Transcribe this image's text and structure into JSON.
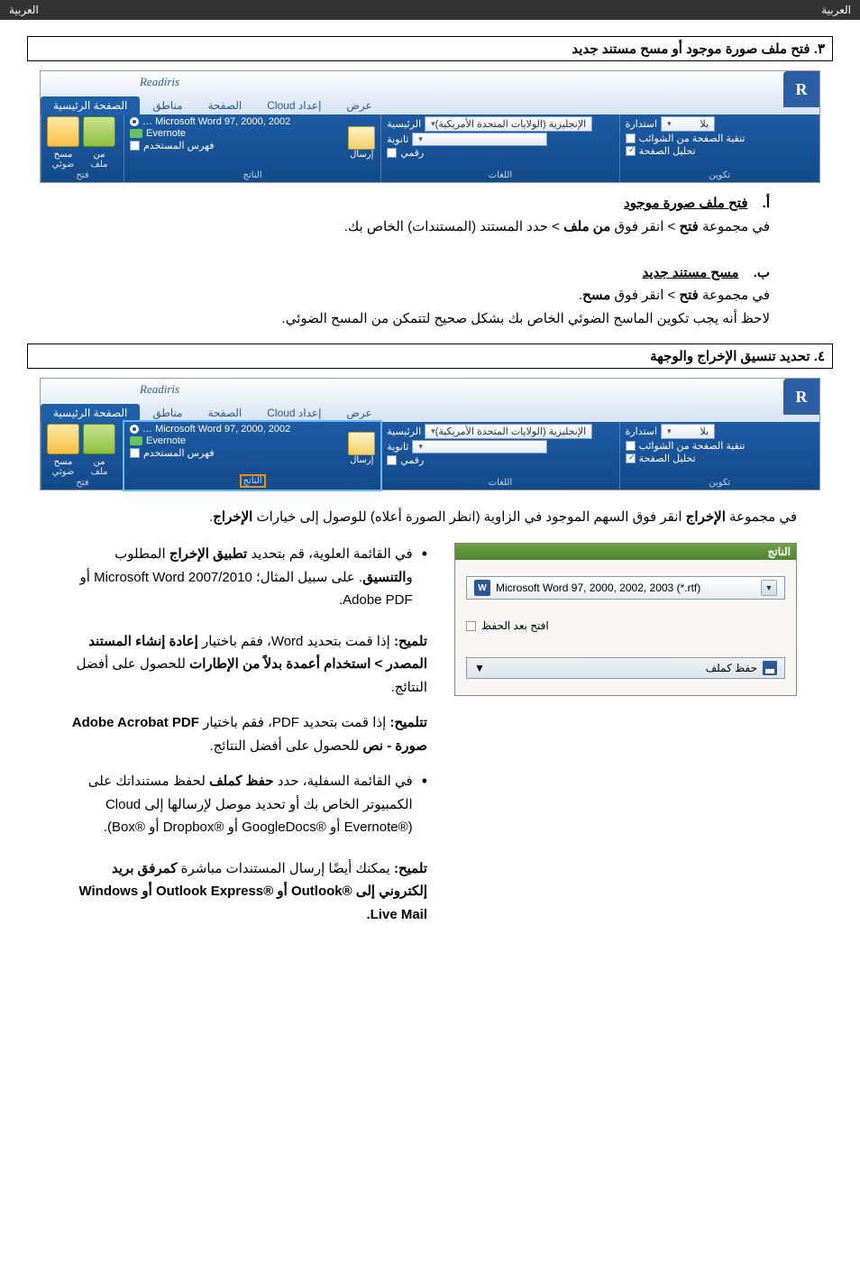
{
  "header": {
    "left": "العربية",
    "right": "العربية"
  },
  "section3": {
    "title": "٣. فتح ملف صورة موجود أو مسح مستند جديد"
  },
  "ribbon": {
    "app_title": "Readiris",
    "tabs": {
      "home": "الصفحة الرئيسية",
      "zones": "مناطق",
      "page": "الصفحة",
      "cloud": "إعداد Cloud",
      "view": "عرض"
    },
    "group_open": {
      "footer": "فتح",
      "scan_top": "مسح",
      "scan_sub": "ضوئي",
      "from_top": "من",
      "from_sub": "ملف"
    },
    "group_output": {
      "footer": "الناتج",
      "row1_radio": "Microsoft Word 97, 2000, 2002 …",
      "row2": "Evernote",
      "row3_chk": "فهرس المستخدم",
      "send": "إرسال"
    },
    "group_lang": {
      "footer": "اللغات",
      "primary_label": "الرئيسية",
      "primary_value": "الإنجليزية (الولايات المتحدة الأمريكية)",
      "secondary_label": "ثانوية",
      "numeric_chk": "رقمي"
    },
    "group_config": {
      "footer": "تكوين",
      "rotate_label": "استدارة",
      "rotate_value": "بلا",
      "deskew": "تنقية الصفحة من الشوائب",
      "analyze": "تحليل الصفحة"
    }
  },
  "section3_body": {
    "a_prefix": "أ.",
    "a_head": "فتح ملف صورة موجود",
    "a_line": "في مجموعة فتح > انقر فوق من ملف > حدد المستند (المستندات) الخاص بك.",
    "b_prefix": "ب.",
    "b_head": "مسح مستند جديد",
    "b_line1": "في مجموعة فتح > انقر فوق مسح.",
    "b_line2": "لاحظ أنه يجب تكوين الماسح الضوئي الخاص بك بشكل صحيح لتتمكن من المسح الضوئي."
  },
  "section4": {
    "title": "٤. تحديد تنسيق الإخراج والوجهة",
    "intro": "في مجموعة الإخراج انقر فوق السهم الموجود في الزاوية (انظر الصورة أعلاه) للوصول إلى خيارات الإخراج."
  },
  "output_panel": {
    "header": "الناتج",
    "dd_value": "Microsoft Word 97, 2000, 2002, 2003 (*.rtf)",
    "openafter": "افتح بعد الحفظ",
    "save_btn": "حفظ كملف"
  },
  "output_text": {
    "bullet1_a": "في القائمة العلوية، قم بتحديد ",
    "bullet1_b": "تطبيق الإخراج",
    "bullet1_c": " المطلوب و",
    "bullet1_d": "التنسيق",
    "bullet1_e": ". على سبيل المثال؛ Microsoft Word 2007/2010 أو Adobe PDF.",
    "tip1_a": "تلميح:",
    "tip1_b": " إذا قمت بتحديد Word، فقم باختيار ",
    "tip1_c": "إعادة إنشاء المستند المصدر > استخدام أعمدة بدلاً من الإطارات",
    "tip1_d": " للحصول على أفضل النتائج.",
    "tip2_a": "تتلميح:",
    "tip2_b": " إذا قمت بتحديد PDF، فقم باختيار ",
    "tip2_c": "Adobe Acrobat PDF صورة - نص",
    "tip2_d": " للحصول على أفضل النتائج.",
    "bullet2_a": "في القائمة السفلية، حدد ",
    "bullet2_b": "حفظ كملف",
    "bullet2_c": " لحفظ مستنداتك على الكمبيوتر الخاص بك أو تحديد موصل لإرسالها إلى Cloud (®Evernote أو ®GoogleDocs أو ®Dropbox أو ®Box).",
    "tip3_a": "تلميح:",
    "tip3_b": " يمكنك أيضًا إرسال المستندات مباشرة ",
    "tip3_c": "كمرفق بريد إلكتروني إلى ®Outlook أو ®Outlook Express أو Windows Live Mail."
  }
}
